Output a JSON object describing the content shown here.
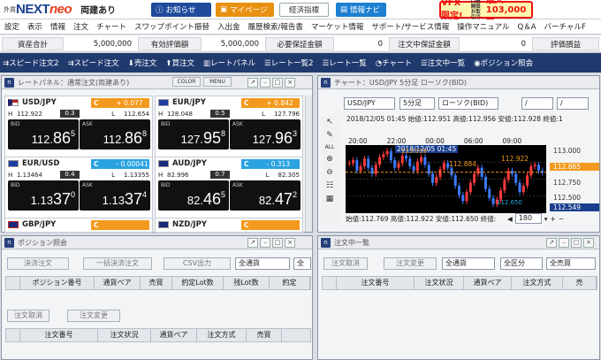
{
  "header": {
    "logo_small": "外貨",
    "logo_main": "NEXT",
    "logo_accent": "neo",
    "account_type": "両建あり",
    "buttons": [
      {
        "label": "お知らせ",
        "color": "#1f4b9c"
      },
      {
        "label": "マイページ",
        "color": "#e8900f"
      },
      {
        "label": "経済指標",
        "color": "#ffffff"
      },
      {
        "label": "情報ナビ",
        "color": "#1d7fd1"
      }
    ],
    "promo": {
      "label": "VFX限定!",
      "sub1": "口座開設",
      "sub2": "お取引で",
      "amount": "最大103,000円"
    }
  },
  "menu": [
    "設定",
    "表示",
    "情報",
    "注文",
    "チャート",
    "スワップポイント振替",
    "入出金",
    "履歴検索/報告書",
    "マーケット情報",
    "サポート/サービス情報",
    "操作マニュアル",
    "Q＆A",
    "バーチャルF"
  ],
  "balance": {
    "labels": [
      "資産合計",
      "有効評価額",
      "必要保証金額",
      "注文中保証金額",
      "評価損益"
    ],
    "values": [
      "5,000,000",
      "5,000,000",
      "0",
      "0"
    ]
  },
  "toolbar": [
    "スピード注文2",
    "スピード注文",
    "売注文",
    "買注文",
    "レートパネル",
    "レート一覧2",
    "レート一覧",
    "チャート",
    "注文中一覧",
    "ポジション照会"
  ],
  "rate_panel": {
    "title": "レートパネル：通常注文(両建あり)",
    "btn_color": "COLOR",
    "btn_menu": "MENU",
    "tiles": [
      {
        "pair": "USD/JPY",
        "c_label": "C",
        "change": "+ 0.077",
        "change_color": "#f39a1e",
        "high_label": "H",
        "high": "112.922",
        "spread": "0.3",
        "low_label": "L",
        "low": "112.654",
        "bid_label": "BID",
        "bid_a": "112.",
        "bid_b": "86",
        "bid_c": "5",
        "ask_label": "ASK",
        "ask_a": "112.",
        "ask_b": "86",
        "ask_c": "8"
      },
      {
        "pair": "EUR/JPY",
        "c_label": "C",
        "change": "+ 0.842",
        "change_color": "#f39a1e",
        "high_label": "H",
        "high": "128.048",
        "spread": "0.5",
        "low_label": "L",
        "low": "127.796",
        "bid_label": "BID",
        "bid_a": "127.",
        "bid_b": "95",
        "bid_c": "8",
        "ask_label": "ASK",
        "ask_a": "127.",
        "ask_b": "96",
        "ask_c": "3"
      },
      {
        "pair": "EUR/USD",
        "c_label": "C",
        "change": "- 0.00041",
        "change_color": "#2aa3e0",
        "high_label": "H",
        "high": "1.13464",
        "spread": "0.4",
        "low_label": "L",
        "low": "1.13355",
        "bid_label": "BID",
        "bid_a": "1.13",
        "bid_b": "37",
        "bid_c": "0",
        "ask_label": "ASK",
        "ask_a": "1.13",
        "ask_b": "37",
        "ask_c": "4"
      },
      {
        "pair": "AUD/JPY",
        "c_label": "C",
        "change": "- 0.313",
        "change_color": "#2aa3e0",
        "high_label": "H",
        "high": "82.996",
        "spread": "0.7",
        "low_label": "L",
        "low": "82.305",
        "bid_label": "BID",
        "bid_a": "82.",
        "bid_b": "46",
        "bid_c": "5",
        "ask_label": "ASK",
        "ask_a": "82.",
        "ask_b": "47",
        "ask_c": "2"
      },
      {
        "pair": "GBP/JPY",
        "c_label": "C",
        "change": "",
        "change_color": "#f39a1e"
      },
      {
        "pair": "NZD/JPY",
        "c_label": "C",
        "change": "",
        "change_color": "#f39a1e"
      }
    ]
  },
  "chart": {
    "title": "チャート：USD/JPY 5分足 ローソク(BID)",
    "pair": "USD/JPY",
    "interval": "5分足",
    "style": "ローソク(BID)",
    "info_top": "2018/12/05 01:45 始値:112.951 高値:112.956 安値:112.928 終値:1",
    "times": [
      "20:00",
      "22:00",
      "00:00",
      "06:00",
      "09:00"
    ],
    "cursor_time": "2018/12/05 01:45",
    "y_labels": [
      "113.000",
      "112.865",
      "112.750",
      "112.500",
      "112.549"
    ],
    "annotations": [
      "113.019",
      "112.884",
      "112.922",
      "112.650"
    ],
    "info_bottom": "始値:112.769 高値:112.922 安値:112.650 終値:",
    "count": "180",
    "series": [
      112.93,
      112.95,
      112.88,
      112.91,
      112.96,
      112.9,
      112.86,
      112.92,
      112.97,
      112.99,
      113.01,
      112.95,
      112.9,
      112.93,
      112.98,
      112.96,
      112.91,
      112.88,
      112.94,
      112.97,
      112.92,
      112.86,
      112.8,
      112.84,
      112.89,
      112.93,
      112.9,
      112.85,
      112.78,
      112.72,
      112.68,
      112.74,
      112.8,
      112.86,
      112.9,
      112.84,
      112.76,
      112.7,
      112.66,
      112.69,
      112.75,
      112.82,
      112.88,
      112.86,
      112.8,
      112.74,
      112.78,
      112.85,
      112.91,
      112.92,
      112.88,
      112.87
    ]
  },
  "position_panel": {
    "title": "ポジション照会",
    "btn_settle": "決済注文",
    "btn_bulk": "一括決済注文",
    "btn_csv": "CSV出力",
    "filter1": "全通貨",
    "filter2": "全",
    "columns": [
      "ポジション番号",
      "通貨ペア",
      "売買",
      "約定Lot数",
      "残Lot数",
      "約定"
    ],
    "btn_cancel": "注文取消",
    "btn_change": "注文変更",
    "columns2": [
      "注文番号",
      "注文状況",
      "通貨ペア",
      "注文方式",
      "売買"
    ]
  },
  "order_panel": {
    "title": "注文中一覧",
    "btn_cancel": "注文取消",
    "btn_change": "注文変更",
    "filter1": "全通貨",
    "filter2": "全区分",
    "filter3": "全売買",
    "columns": [
      "注文番号",
      "注文状況",
      "通貨ペア",
      "注文方式",
      "売"
    ]
  }
}
